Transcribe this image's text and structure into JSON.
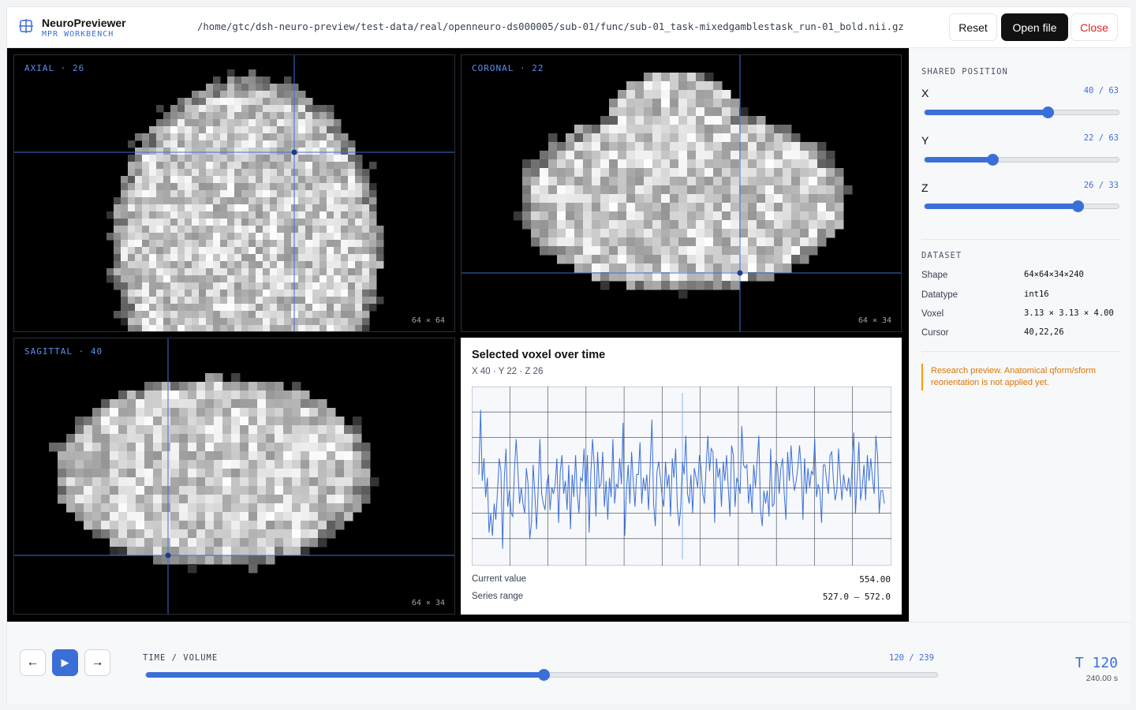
{
  "app": {
    "title": "NeuroPreviewer",
    "subtitle": "MPR WORKBENCH",
    "file_path": "/home/gtc/dsh-neuro-preview/test-data/real/openneuro-ds000005/sub-01/func/sub-01_task-mixedgamblestask_run-01_bold.nii.gz"
  },
  "toolbar": {
    "reset_label": "Reset",
    "open_label": "Open file",
    "close_label": "Close"
  },
  "views": {
    "axial": {
      "label": "AXIAL · 26",
      "dims": "64 × 64"
    },
    "coronal": {
      "label": "CORONAL · 22",
      "dims": "64 × 34"
    },
    "sagittal": {
      "label": "SAGITTAL · 40",
      "dims": "64 × 34"
    }
  },
  "timeseries": {
    "title": "Selected voxel over time",
    "subtitle": "X 40 · Y 22 · Z 26",
    "current_label": "Current value",
    "current_value": "554.00",
    "range_label": "Series range",
    "range_value": "527.0 – 572.0"
  },
  "position": {
    "title": "SHARED POSITION",
    "axes": [
      {
        "name": "X",
        "value": "40 / 63",
        "fraction": 0.635
      },
      {
        "name": "Y",
        "value": "22 / 63",
        "fraction": 0.349
      },
      {
        "name": "Z",
        "value": "26 / 33",
        "fraction": 0.788
      }
    ]
  },
  "dataset": {
    "title": "DATASET",
    "rows": [
      {
        "key": "Shape",
        "value": "64×64×34×240"
      },
      {
        "key": "Datatype",
        "value": "int16"
      },
      {
        "key": "Voxel",
        "value": "3.13 × 3.13 × 4.00"
      },
      {
        "key": "Cursor",
        "value": "40,22,26"
      }
    ],
    "note": "Research preview. Anatomical qform/sform reorientation is not applied yet."
  },
  "time": {
    "label": "TIME / VOLUME",
    "value": "120 / 239",
    "fraction": 0.502,
    "big": "T 120",
    "seconds": "240.00 s",
    "prev_icon": "←",
    "next_icon": "→",
    "play_icon": "▶"
  },
  "chart_data": {
    "type": "line",
    "title": "Selected voxel over time",
    "xlim": [
      0,
      239
    ],
    "ylim": [
      522,
      577
    ],
    "current_x": 120,
    "grid": true,
    "series": [
      {
        "values": [
          550,
          570,
          548,
          555,
          543,
          549,
          532,
          538,
          531,
          541,
          536,
          545,
          555,
          551,
          527,
          549,
          558,
          540,
          545,
          538,
          537,
          552,
          561,
          551,
          541,
          546,
          541,
          538,
          552,
          547,
          530,
          535,
          553,
          544,
          533,
          546,
          561,
          544,
          541,
          539,
          547,
          550,
          539,
          546,
          544,
          547,
          555,
          535,
          551,
          556,
          544,
          548,
          539,
          553,
          533,
          550,
          543,
          556,
          544,
          538,
          549,
          548,
          558,
          543,
          556,
          532,
          550,
          561,
          553,
          537,
          557,
          546,
          547,
          557,
          540,
          548,
          536,
          549,
          543,
          561,
          541,
          547,
          546,
          555,
          547,
          566,
          531,
          545,
          553,
          541,
          557,
          548,
          540,
          550,
          550,
          560,
          541,
          549,
          545,
          550,
          539,
          553,
          567,
          541,
          534,
          551,
          554,
          549,
          543,
          540,
          554,
          546,
          550,
          537,
          555,
          549,
          558,
          540,
          534,
          540,
          554,
          550,
          562,
          544,
          541,
          550,
          538,
          552,
          549,
          546,
          556,
          552,
          544,
          541,
          553,
          562,
          551,
          558,
          557,
          535,
          555,
          549,
          552,
          540,
          554,
          548,
          556,
          546,
          537,
          559,
          556,
          540,
          549,
          547,
          544,
          565,
          553,
          552,
          553,
          541,
          547,
          538,
          553,
          546,
          554,
          562,
          539,
          534,
          545,
          541,
          545,
          537,
          558,
          540,
          541,
          554,
          553,
          544,
          552,
          555,
          544,
          536,
          557,
          548,
          559,
          550,
          545,
          548,
          552,
          559,
          552,
          536,
          555,
          544,
          552,
          546,
          551,
          550,
          561,
          543,
          547,
          545,
          535,
          553,
          553,
          548,
          544,
          556,
          557,
          548,
          542,
          545,
          558,
          549,
          542,
          550,
          546,
          545,
          549,
          543,
          553,
          563,
          538,
          549,
          560,
          542,
          546,
          553,
          542,
          556,
          548,
          555,
          549,
          544,
          562,
          556,
          538,
          545,
          545,
          541
        ]
      }
    ]
  }
}
